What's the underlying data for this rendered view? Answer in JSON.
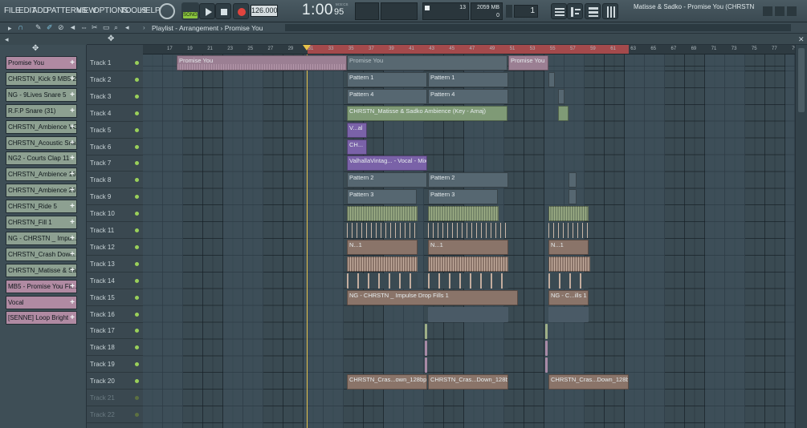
{
  "menu": [
    "FILE",
    "EDIT",
    "ADD",
    "PATTERNS",
    "VIEW",
    "OPTIONS",
    "TOOLS",
    "HELP"
  ],
  "transport": {
    "mode": "SONG",
    "tempo": "126.000",
    "time": "1:00",
    "time_sub": "95",
    "time_unit": "M:S:CS",
    "cpu": "13",
    "memory": "2059 MB",
    "voices": "0",
    "pattern_num": "1"
  },
  "title": "Matisse & Sadko - Promise You (CHRSTN",
  "breadcrumb": {
    "prefix": "Playlist",
    "sep": " - ",
    "view": "Arrangement",
    "sep2": " › ",
    "pattern": "Promise You",
    "arrow": "›"
  },
  "ruler_ticks": [
    "17",
    "19",
    "21",
    "23",
    "25",
    "27",
    "29",
    "31",
    "33",
    "35",
    "37",
    "39",
    "41",
    "43",
    "45",
    "47",
    "49",
    "51",
    "53",
    "55",
    "57",
    "59",
    "61",
    "63",
    "65",
    "67",
    "69",
    "71",
    "73",
    "75",
    "77",
    "79",
    "81"
  ],
  "channels": [
    {
      "name": "Promise You",
      "color": "#b08aa2"
    },
    {
      "name": "CHRSTN_Kick 9 MB5 2",
      "color": "#8da091"
    },
    {
      "name": "NG - 9Lives Snare 5",
      "color": "#8da091"
    },
    {
      "name": "R.F.P Snare (31)",
      "color": "#8da091"
    },
    {
      "name": "CHRSTN_Ambience VO...",
      "color": "#8da091"
    },
    {
      "name": "CHRSTN_Acoustic Sna...",
      "color": "#8da091"
    },
    {
      "name": "NG2 - Courts Clap 11",
      "color": "#8da091"
    },
    {
      "name": "CHRSTN_Ambience 16...",
      "color": "#8da091"
    },
    {
      "name": "CHRSTN_Ambience 26...",
      "color": "#8da091"
    },
    {
      "name": "CHRSTN_Ride 5",
      "color": "#8da091"
    },
    {
      "name": "CHRSTN_Fill 1",
      "color": "#8da091"
    },
    {
      "name": "NG - CHRSTN _ Impul...",
      "color": "#8da091"
    },
    {
      "name": "CHRSTN_Crash Down...",
      "color": "#8da091"
    },
    {
      "name": "CHRSTN_Matisse & Sa...",
      "color": "#8da091"
    },
    {
      "name": "MB5 - Promise You Fill...",
      "color": "#b08aa2"
    },
    {
      "name": "Vocal",
      "color": "#b08aa2"
    },
    {
      "name": "[SENNE] Loop Bright",
      "color": "#b08aa2"
    }
  ],
  "tracks": [
    "Track 1",
    "Track 2",
    "Track 3",
    "Track 4",
    "Track 5",
    "Track 6",
    "Track 7",
    "Track 8",
    "Track 9",
    "Track 10",
    "Track 11",
    "Track 12",
    "Track 13",
    "Track 14",
    "Track 15",
    "Track 16",
    "Track 17",
    "Track 18",
    "Track 19",
    "Track 20",
    "Track 21",
    "Track 22"
  ],
  "clips": {
    "promise1": "Promise You",
    "promise2": "Promise You",
    "promise3": "Promise You",
    "pattern1": "Pattern 1",
    "pattern4": "Pattern 4",
    "ambience": "CHRSTN_Matisse & Sadko Ambience (Key - Amaj)",
    "vocal_short": "V...al",
    "ch_short": "CH...",
    "valhalla": "ValhallaVintag... - Vocal - Mix",
    "pattern2": "Pattern 2",
    "pattern3": "Pattern 3",
    "n1": "N...1",
    "impulse": "NG - CHRSTN _ Impulse Drop Fills 1",
    "impulse2": "NG - C...ills 1",
    "crash": "CHRSTN_Cras...own_128bpm",
    "crash2": "CHRSTN_Cras...Down_128bpm",
    "crash3": "CHRSTN_Cras...Down_128bpm"
  },
  "colors": {
    "sample_pink": "#9b7f93",
    "pattern_gray": "#586871",
    "audio_green": "#7f9a76",
    "vocal_purple": "#7a62a8",
    "drop_brown": "#8a7469",
    "playhead": "#e6c24a",
    "loop_red": "#d45a5a"
  }
}
